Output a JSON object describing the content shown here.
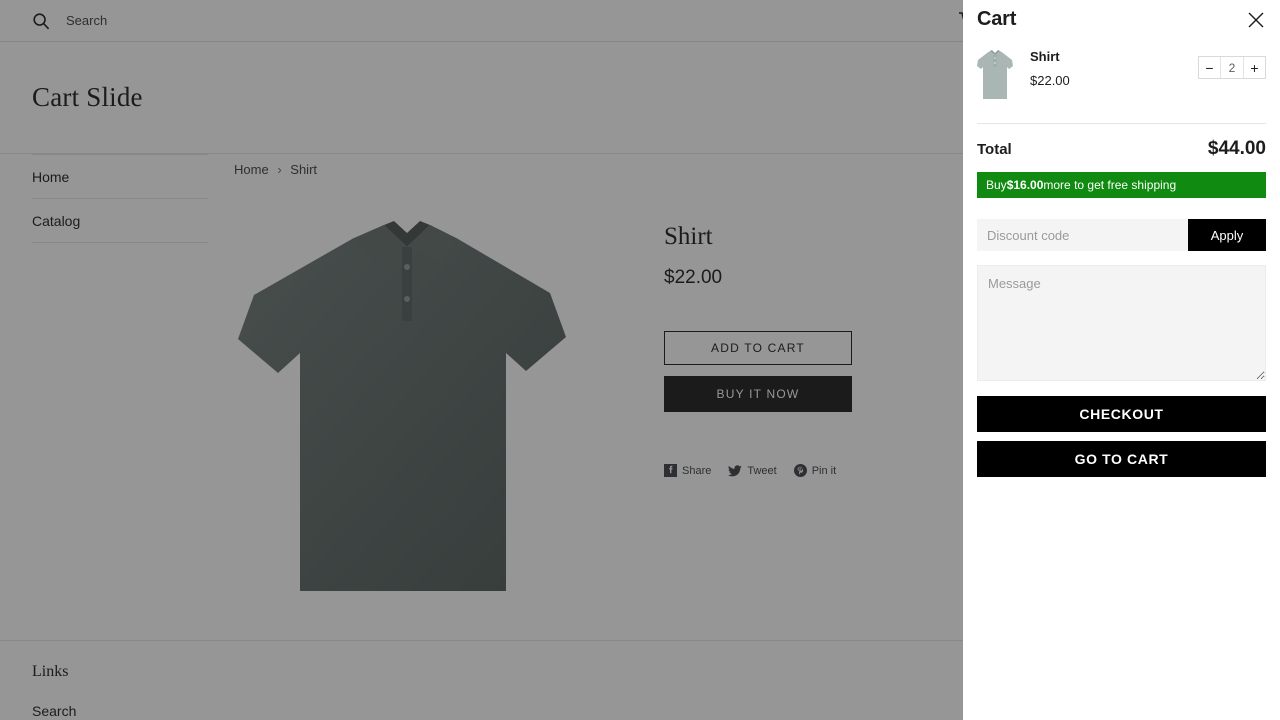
{
  "page": {
    "header": {
      "search_placeholder": "Search",
      "search_value": "",
      "search_icon": "search-icon",
      "cart_icon": "shopping-cart-icon"
    },
    "site_title": "Cart Slide",
    "sidebar": {
      "items": [
        {
          "label": "Home"
        },
        {
          "label": "Catalog"
        }
      ]
    },
    "breadcrumb": {
      "home": "Home",
      "separator": "›",
      "current": "Shirt"
    },
    "product": {
      "title": "Shirt",
      "price": "$22.00",
      "add_to_cart_label": "ADD TO CART",
      "buy_now_label": "BUY IT NOW",
      "image_alt": "grey-green polo shirt",
      "share": [
        {
          "label": "Share",
          "icon": "facebook-icon"
        },
        {
          "label": "Tweet",
          "icon": "twitter-icon"
        },
        {
          "label": "Pin it",
          "icon": "pinterest-icon"
        }
      ]
    },
    "footer": {
      "heading": "Links",
      "links": [
        {
          "label": "Search"
        }
      ]
    }
  },
  "cart_drawer": {
    "title": "Cart",
    "close_icon": "close-icon",
    "items": [
      {
        "name": "Shirt",
        "price": "$22.00",
        "quantity": "2",
        "decrease_label": "−",
        "increase_label": "+",
        "thumb_alt": "grey-green polo shirt"
      }
    ],
    "total": {
      "label": "Total",
      "value": "$44.00"
    },
    "free_shipping": {
      "prefix": "Buy ",
      "amount": "$16.00",
      "suffix": " more to get free shipping",
      "background_color": "#108a10"
    },
    "discount": {
      "placeholder": "Discount code",
      "value": "",
      "apply_label": "Apply"
    },
    "message": {
      "placeholder": "Message",
      "value": ""
    },
    "checkout_label": "CHECKOUT",
    "go_to_cart_label": "GO TO CART"
  },
  "colors": {
    "accent_green": "#108a10",
    "button_black": "#000000",
    "text": "#1c1d1d"
  }
}
